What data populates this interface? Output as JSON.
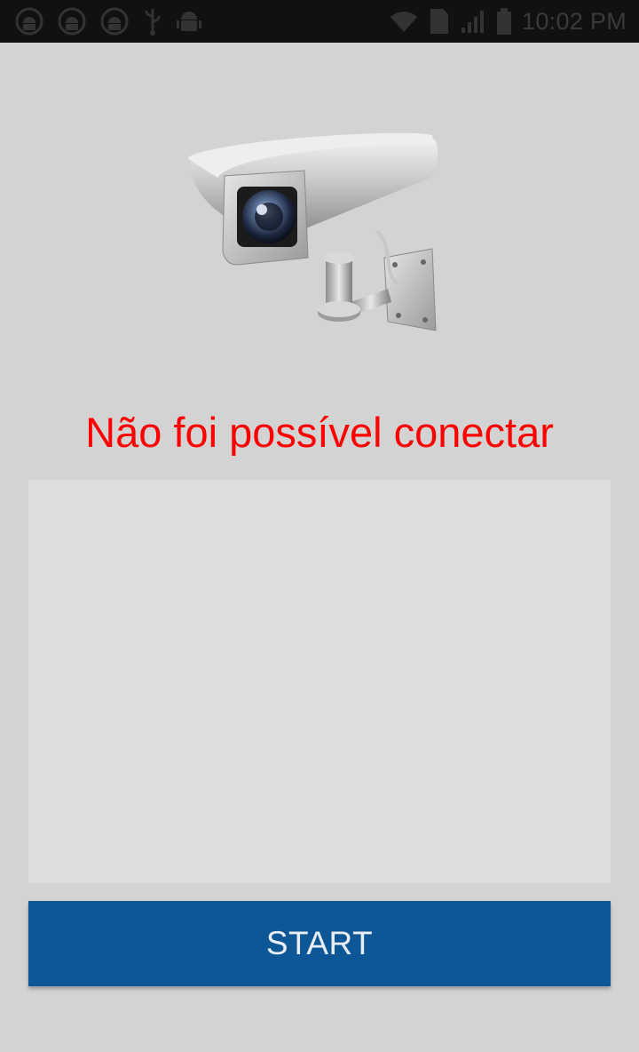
{
  "status_bar": {
    "time": "10:02 PM",
    "left_icons": [
      "android-robot-badge-icon",
      "android-robot-badge-icon",
      "android-robot-badge-icon",
      "usb-icon",
      "android-debug-icon"
    ],
    "right_icons": [
      "wifi-icon",
      "sim-card-icon",
      "signal-icon",
      "battery-icon"
    ]
  },
  "main": {
    "camera_icon": "security-camera-icon",
    "status_text": "Não foi possível conectar",
    "status_color": "#ff0000",
    "start_label": "START",
    "accent": "#0d5796"
  }
}
